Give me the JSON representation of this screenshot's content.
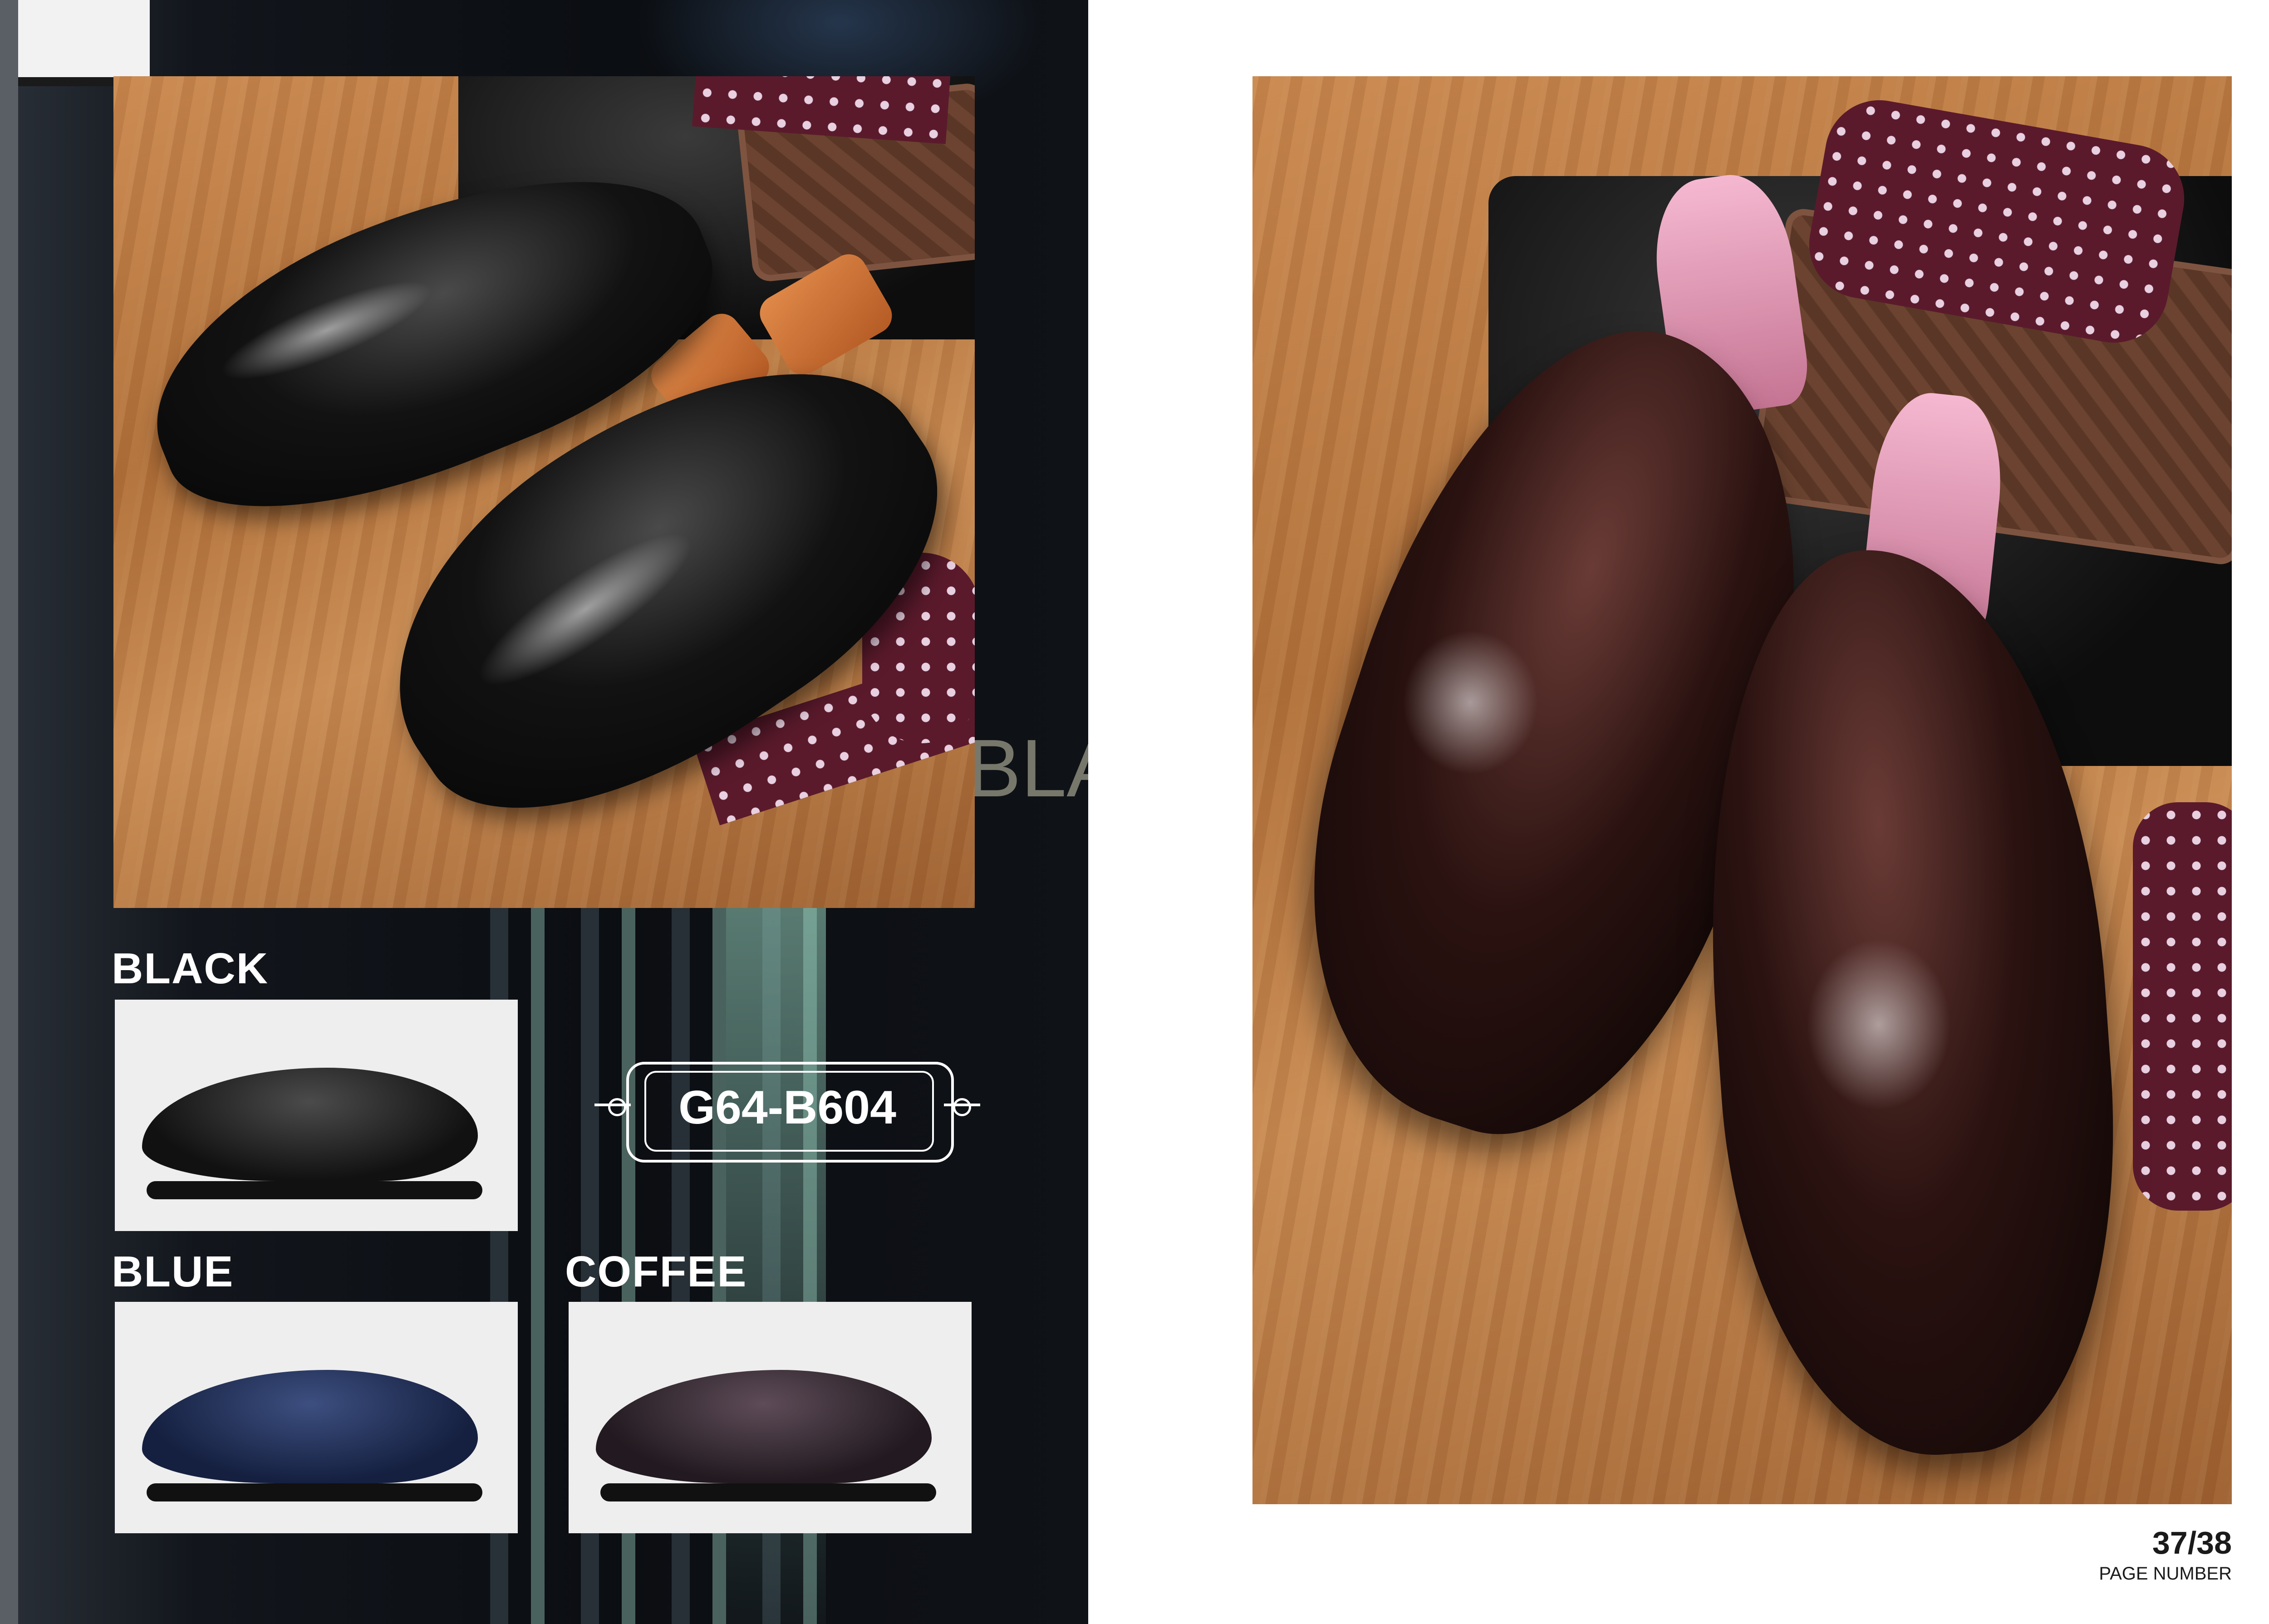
{
  "catalog": {
    "model_code": "G64-B604",
    "background_text": "BLAC",
    "colors": [
      {
        "label": "BLACK",
        "swatch": "#1b1b1b"
      },
      {
        "label": "BLUE",
        "swatch": "#1f2d4e"
      },
      {
        "label": "COFFEE",
        "swatch": "#3a2d35"
      }
    ]
  },
  "page": {
    "number": "37/38",
    "caption": "PAGE NUMBER"
  },
  "palette": {
    "left_bg": "#0b0e12",
    "wood": "#b0703a",
    "swatch_bg": "#eeeeee",
    "tie": "#5a1a2c"
  }
}
